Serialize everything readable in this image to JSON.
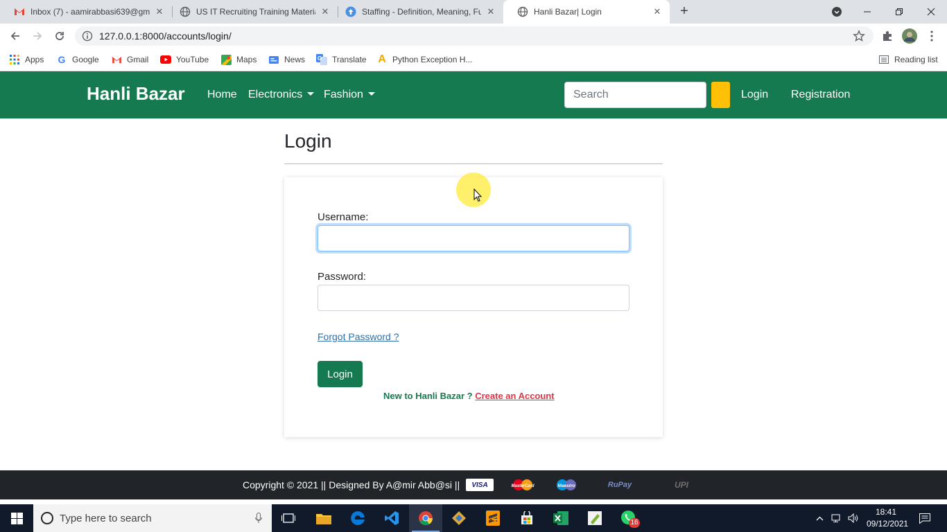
{
  "browser": {
    "tabs": [
      {
        "title": "Inbox (7) - aamirabbasi639@gma",
        "favicon": "gmail-icon"
      },
      {
        "title": "US IT Recruiting Training Materia",
        "favicon": "globe-icon"
      },
      {
        "title": "Staffing - Definition, Meaning, Fu",
        "favicon": "upload-icon"
      },
      {
        "title": "Hanli Bazar| Login",
        "favicon": "globe-icon",
        "active": true
      }
    ],
    "url": "127.0.0.1:8000/accounts/login/",
    "bookmarks": [
      "Apps",
      "Google",
      "Gmail",
      "YouTube",
      "Maps",
      "News",
      "Translate",
      "Python Exception H..."
    ],
    "reading_list": "Reading list"
  },
  "site": {
    "brand": "Hanli Bazar",
    "nav": {
      "home": "Home",
      "electronics": "Electronics",
      "fashion": "Fashion",
      "search_placeholder": "Search",
      "login": "Login",
      "registration": "Registration"
    },
    "colors": {
      "primary": "#157a50",
      "search_button": "#ffc107",
      "link_danger": "#dc3545"
    }
  },
  "login_page": {
    "title": "Login",
    "username_label": "Username:",
    "username_value": "",
    "password_label": "Password:",
    "password_value": "",
    "forgot_password": "Forgot Password ?",
    "submit": "Login",
    "new_user_text": "New to Hanli Bazar ?",
    "create_account": "Create an Account"
  },
  "footer": {
    "copyright": "Copyright © 2021 || Designed By A@mir Abb@si ||",
    "payment_icons": [
      "VISA",
      "MasterCard",
      "Maestro",
      "RuPay",
      "UPI"
    ]
  },
  "taskbar": {
    "search_placeholder": "Type here to search",
    "whatsapp_badge": "16",
    "time": "18:41",
    "date": "09/12/2021"
  }
}
